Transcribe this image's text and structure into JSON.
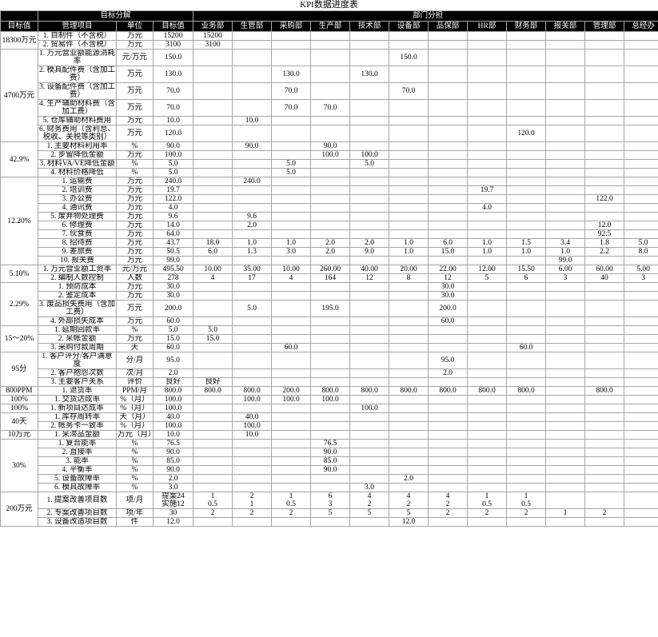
{
  "title": "KPI数据进度表",
  "header": {
    "group_target": "目标分解",
    "group_dept": "部门分担",
    "col_target_value": "目标值",
    "col_item": "管理项目",
    "col_unit": "单位",
    "col_goal": "目标值",
    "departments": [
      "业务部",
      "生管部",
      "采购部",
      "生产部",
      "技术部",
      "设备部",
      "品保部",
      "HR部",
      "财务部",
      "报关部",
      "管理部",
      "总经办"
    ]
  },
  "groups": [
    {
      "target": "18300万元",
      "rows": [
        {
          "item": "1. 自制件（不含税）",
          "unit": "万元",
          "goal": "15200",
          "dept": [
            "15200",
            "",
            "",
            "",
            "",
            "",
            "",
            "",
            "",
            "",
            "",
            ""
          ]
        },
        {
          "item": "2. 贸易件（不含税）",
          "unit": "万元",
          "goal": "3100",
          "dept": [
            "3100",
            "",
            "",
            "",
            "",
            "",
            "",
            "",
            "",
            "",
            "",
            ""
          ]
        }
      ]
    },
    {
      "target": "4700万元",
      "rows": [
        {
          "item": "1. 万元营业额能源消耗率",
          "unit": "元/万元",
          "goal": "150.0",
          "dept": [
            "",
            "",
            "",
            "",
            "",
            "150.0",
            "",
            "",
            "",
            "",
            "",
            ""
          ]
        },
        {
          "item": "2. 模具配件费（含加工费）",
          "unit": "万元",
          "goal": "130.0",
          "dept": [
            "",
            "",
            "130.0",
            "",
            "130.0",
            "",
            "",
            "",
            "",
            "",
            "",
            ""
          ]
        },
        {
          "item": "3. 设备配件费（含加工费）",
          "unit": "万元",
          "goal": "70.0",
          "dept": [
            "",
            "",
            "70.0",
            "",
            "",
            "70.0",
            "",
            "",
            "",
            "",
            "",
            ""
          ]
        },
        {
          "item": "4. 生产辅助材料费（含加工费）",
          "unit": "万元",
          "goal": "70.0",
          "dept": [
            "",
            "",
            "70.0",
            "70.0",
            "",
            "",
            "",
            "",
            "",
            "",
            "",
            ""
          ]
        },
        {
          "item": "5. 仓库辅助材料费用",
          "unit": "万元",
          "goal": "10.0",
          "dept": [
            "",
            "10.0",
            "",
            "",
            "",
            "",
            "",
            "",
            "",
            "",
            "",
            ""
          ]
        },
        {
          "item": "6. 财务费用（含利息、税收、关税等类别）",
          "unit": "万元",
          "goal": "120.0",
          "dept": [
            "",
            "",
            "",
            "",
            "",
            "",
            "",
            "",
            "120.0",
            "",
            "",
            ""
          ]
        }
      ]
    },
    {
      "target": "42.9%",
      "rows": [
        {
          "item": "1. 主要材料利用率",
          "unit": "%",
          "goal": "90.0",
          "dept": [
            "",
            "90.0",
            "",
            "90.0",
            "",
            "",
            "",
            "",
            "",
            "",
            "",
            ""
          ]
        },
        {
          "item": "2. 步留降低金额",
          "unit": "万元",
          "goal": "100.0",
          "dept": [
            "",
            "",
            "",
            "100.0",
            "100.0",
            "",
            "",
            "",
            "",
            "",
            "",
            ""
          ]
        },
        {
          "item": "3. 材料VA/VE降低金额",
          "unit": "%",
          "goal": "5.0",
          "dept": [
            "",
            "",
            "5.0",
            "",
            "5.0",
            "",
            "",
            "",
            "",
            "",
            "",
            ""
          ]
        },
        {
          "item": "4. 材料价格降低",
          "unit": "%",
          "goal": "5.0",
          "dept": [
            "",
            "",
            "5.0",
            "",
            "",
            "",
            "",
            "",
            "",
            "",
            "",
            ""
          ]
        }
      ]
    },
    {
      "target": "12.20%",
      "rows": [
        {
          "item": "1. 运输费",
          "unit": "万元",
          "goal": "240.0",
          "dept": [
            "",
            "240.0",
            "",
            "",
            "",
            "",
            "",
            "",
            "",
            "",
            "",
            ""
          ]
        },
        {
          "item": "2. 培训费",
          "unit": "万元",
          "goal": "19.7",
          "dept": [
            "",
            "",
            "",
            "",
            "",
            "",
            "",
            "19.7",
            "",
            "",
            "",
            ""
          ]
        },
        {
          "item": "3. 办公费",
          "unit": "万元",
          "goal": "122.0",
          "dept": [
            "",
            "",
            "",
            "",
            "",
            "",
            "",
            "",
            "",
            "",
            "122.0",
            ""
          ]
        },
        {
          "item": "4. 通讯费",
          "unit": "万元",
          "goal": "4.0",
          "dept": [
            "",
            "",
            "",
            "",
            "",
            "",
            "",
            "4.0",
            "",
            "",
            "",
            ""
          ]
        },
        {
          "item": "5. 废弃物处理费",
          "unit": "万元",
          "goal": "9.6",
          "dept": [
            "",
            "9.6",
            "",
            "",
            "",
            "",
            "",
            "",
            "",
            "",
            "",
            ""
          ]
        },
        {
          "item": "6. 修理费",
          "unit": "万元",
          "goal": "14.0",
          "dept": [
            "",
            "2.0",
            "",
            "",
            "",
            "",
            "",
            "",
            "",
            "",
            "12.0",
            ""
          ]
        },
        {
          "item": "7. 伙食费",
          "unit": "万元",
          "goal": "64.0",
          "dept": [
            "",
            "",
            "",
            "",
            "",
            "",
            "",
            "",
            "",
            "",
            "92.5",
            ""
          ]
        },
        {
          "item": "8. 招待费",
          "unit": "万元",
          "goal": "43.7",
          "dept": [
            "18.0",
            "1.0",
            "1.0",
            "2.0",
            "2.0",
            "1.0",
            "6.0",
            "1.0",
            "1.5",
            "3.4",
            "1.8",
            "5.0"
          ]
        },
        {
          "item": "9. 差旅费",
          "unit": "万元",
          "goal": "50.5",
          "dept": [
            "6.0",
            "1.3",
            "3.0",
            "2.0",
            "9.0",
            "1.0",
            "15.0",
            "1.0",
            "1.0",
            "1.0",
            "2.2",
            "8.0"
          ]
        },
        {
          "item": "10. 报关费",
          "unit": "万元",
          "goal": "99.0",
          "dept": [
            "",
            "",
            "",
            "",
            "",
            "",
            "",
            "",
            "",
            "99.0",
            "",
            ""
          ]
        }
      ]
    },
    {
      "target": "5.10%",
      "rows": [
        {
          "item": "1. 万元营业额工资率",
          "unit": "元/万元",
          "goal": "495.50",
          "dept": [
            "10.00",
            "35.00",
            "10.00",
            "260.00",
            "40.00",
            "20.00",
            "22.00",
            "12.00",
            "15.50",
            "6.00",
            "60.00",
            "5.00"
          ]
        },
        {
          "item": "2. 编制人数控制",
          "unit": "人数",
          "goal": "278",
          "dept": [
            "4",
            "17",
            "4",
            "164",
            "12",
            "8",
            "12",
            "5",
            "6",
            "3",
            "40",
            "3"
          ]
        }
      ]
    },
    {
      "target": "2.29%",
      "rows": [
        {
          "item": "1. 预防成本",
          "unit": "万元",
          "goal": "30.0",
          "dept": [
            "",
            "",
            "",
            "",
            "",
            "",
            "30.0",
            "",
            "",
            "",
            "",
            ""
          ]
        },
        {
          "item": "2. 鉴定成本",
          "unit": "万元",
          "goal": "30.0",
          "dept": [
            "",
            "",
            "",
            "",
            "",
            "",
            "30.0",
            "",
            "",
            "",
            "",
            ""
          ]
        },
        {
          "item": "3. 废品损失费用（含加工费）",
          "unit": "万元",
          "goal": "200.0",
          "dept": [
            "",
            "5.0",
            "",
            "195.0",
            "",
            "",
            "200.0",
            "",
            "",
            "",
            "",
            ""
          ]
        },
        {
          "item": "4. 外部损失成本",
          "unit": "万元",
          "goal": "60.0",
          "dept": [
            "",
            "",
            "",
            "",
            "",
            "",
            "60.0",
            "",
            "",
            "",
            "",
            ""
          ]
        }
      ]
    },
    {
      "target": "15～20%",
      "rows": [
        {
          "item": "1. 延期回款率",
          "unit": "%",
          "goal": "5.0",
          "dept": [
            "5.0",
            "",
            "",
            "",
            "",
            "",
            "",
            "",
            "",
            "",
            "",
            ""
          ]
        },
        {
          "item": "2. 呆帐金额",
          "unit": "万元",
          "goal": "15.0",
          "dept": [
            "15.0",
            "",
            "",
            "",
            "",
            "",
            "",
            "",
            "",
            "",
            "",
            ""
          ]
        },
        {
          "item": "3. 采购付款周期",
          "unit": "天",
          "goal": "60.0",
          "dept": [
            "",
            "",
            "60.0",
            "",
            "",
            "",
            "",
            "",
            "60.0",
            "",
            "",
            ""
          ]
        }
      ]
    },
    {
      "target": "95分",
      "rows": [
        {
          "item": "1. 客户评分/客户满意度",
          "unit": "分/月",
          "goal": "95.0",
          "dept": [
            "",
            "",
            "",
            "",
            "",
            "",
            "95.0",
            "",
            "",
            "",
            "",
            ""
          ]
        },
        {
          "item": "2. 客户抱怨次数",
          "unit": "次/月",
          "goal": "2.0",
          "dept": [
            "",
            "",
            "",
            "",
            "",
            "",
            "2.0",
            "",
            "",
            "",
            "",
            ""
          ]
        },
        {
          "item": "3. 主要客户关系",
          "unit": "评价",
          "goal": "良好",
          "dept": [
            "良好",
            "",
            "",
            "",
            "",
            "",
            "",
            "",
            "",
            "",
            "",
            ""
          ]
        }
      ]
    },
    {
      "target": "800PPM",
      "rows": [
        {
          "item": "1. 退货率",
          "unit": "PPM/月",
          "goal": "800.0",
          "dept": [
            "800.0",
            "800.0",
            "200.0",
            "800.0",
            "800.0",
            "800.0",
            "800.0",
            "800.0",
            "800.0",
            "",
            "800.0",
            ""
          ]
        }
      ]
    },
    {
      "target": "100%",
      "rows": [
        {
          "item": "1. 交货达成率",
          "unit": "%（月）",
          "goal": "100.0",
          "dept": [
            "",
            "100.0",
            "100.0",
            "100.0",
            "",
            "",
            "",
            "",
            "",
            "",
            "",
            ""
          ]
        }
      ]
    },
    {
      "target": "100%",
      "rows": [
        {
          "item": "1. 新项目达成率",
          "unit": "%（月）",
          "goal": "100.0",
          "dept": [
            "",
            "",
            "",
            "",
            "100.0",
            "",
            "",
            "",
            "",
            "",
            "",
            ""
          ]
        }
      ]
    },
    {
      "target": "40天",
      "rows": [
        {
          "item": "1. 库存周转率",
          "unit": "天（月）",
          "goal": "40.0",
          "dept": [
            "",
            "40.0",
            "",
            "",
            "",
            "",
            "",
            "",
            "",
            "",
            "",
            ""
          ]
        },
        {
          "item": "2. 帐务卡一致率",
          "unit": "%（月）",
          "goal": "100.0",
          "dept": [
            "",
            "100.0",
            "",
            "",
            "",
            "",
            "",
            "",
            "",
            "",
            "",
            ""
          ]
        }
      ]
    },
    {
      "target": "10万元",
      "rows": [
        {
          "item": "1. 呆滞品金额",
          "unit": "万元（月）",
          "goal": "10.0",
          "dept": [
            "",
            "10.0",
            "",
            "",
            "",
            "",
            "",
            "",
            "",
            "",
            "",
            ""
          ]
        }
      ]
    },
    {
      "target": "30%",
      "rows": [
        {
          "item": "1. 复合能率",
          "unit": "%",
          "goal": "76.5",
          "dept": [
            "",
            "",
            "",
            "76.5",
            "",
            "",
            "",
            "",
            "",
            "",
            "",
            ""
          ]
        },
        {
          "item": "2. 直接率",
          "unit": "%",
          "goal": "90.0",
          "dept": [
            "",
            "",
            "",
            "90.0",
            "",
            "",
            "",
            "",
            "",
            "",
            "",
            ""
          ]
        },
        {
          "item": "3. 能率",
          "unit": "%",
          "goal": "85.0",
          "dept": [
            "",
            "",
            "",
            "85.0",
            "",
            "",
            "",
            "",
            "",
            "",
            "",
            ""
          ]
        },
        {
          "item": "4. 平衡率",
          "unit": "%",
          "goal": "90.0",
          "dept": [
            "",
            "",
            "",
            "90.0",
            "",
            "",
            "",
            "",
            "",
            "",
            "",
            ""
          ]
        },
        {
          "item": "5. 设备故障率",
          "unit": "%",
          "goal": "2.0",
          "dept": [
            "",
            "",
            "",
            "",
            "",
            "2.0",
            "",
            "",
            "",
            "",
            "",
            ""
          ]
        },
        {
          "item": "6. 模具故障率",
          "unit": "%",
          "goal": "3.0",
          "dept": [
            "",
            "",
            "",
            "",
            "3.0",
            "",
            "",
            "",
            "",
            "",
            "",
            ""
          ]
        }
      ]
    },
    {
      "target": "200万元",
      "rows": [
        {
          "item": "1. 提案改善项目数",
          "unit": "项/月",
          "goal": "提案24\n实施12",
          "dept": [
            "1\n0.5",
            "2\n1",
            "1\n0.5",
            "6\n3",
            "4\n2",
            "4\n2",
            "4\n2",
            "1\n0.5",
            "1\n0.5",
            "",
            "",
            ""
          ]
        },
        {
          "item": "2. 专案改善项目数",
          "unit": "项/年",
          "goal": "30",
          "dept": [
            "2",
            "2",
            "2",
            "5",
            "5",
            "5",
            "2",
            "2",
            "2",
            "1",
            "2",
            ""
          ]
        },
        {
          "item": "3. 设备改造项目数",
          "unit": "件",
          "goal": "12.0",
          "dept": [
            "",
            "",
            "",
            "",
            "",
            "12.0",
            "",
            "",
            "",
            "",
            "",
            ""
          ]
        }
      ]
    }
  ]
}
